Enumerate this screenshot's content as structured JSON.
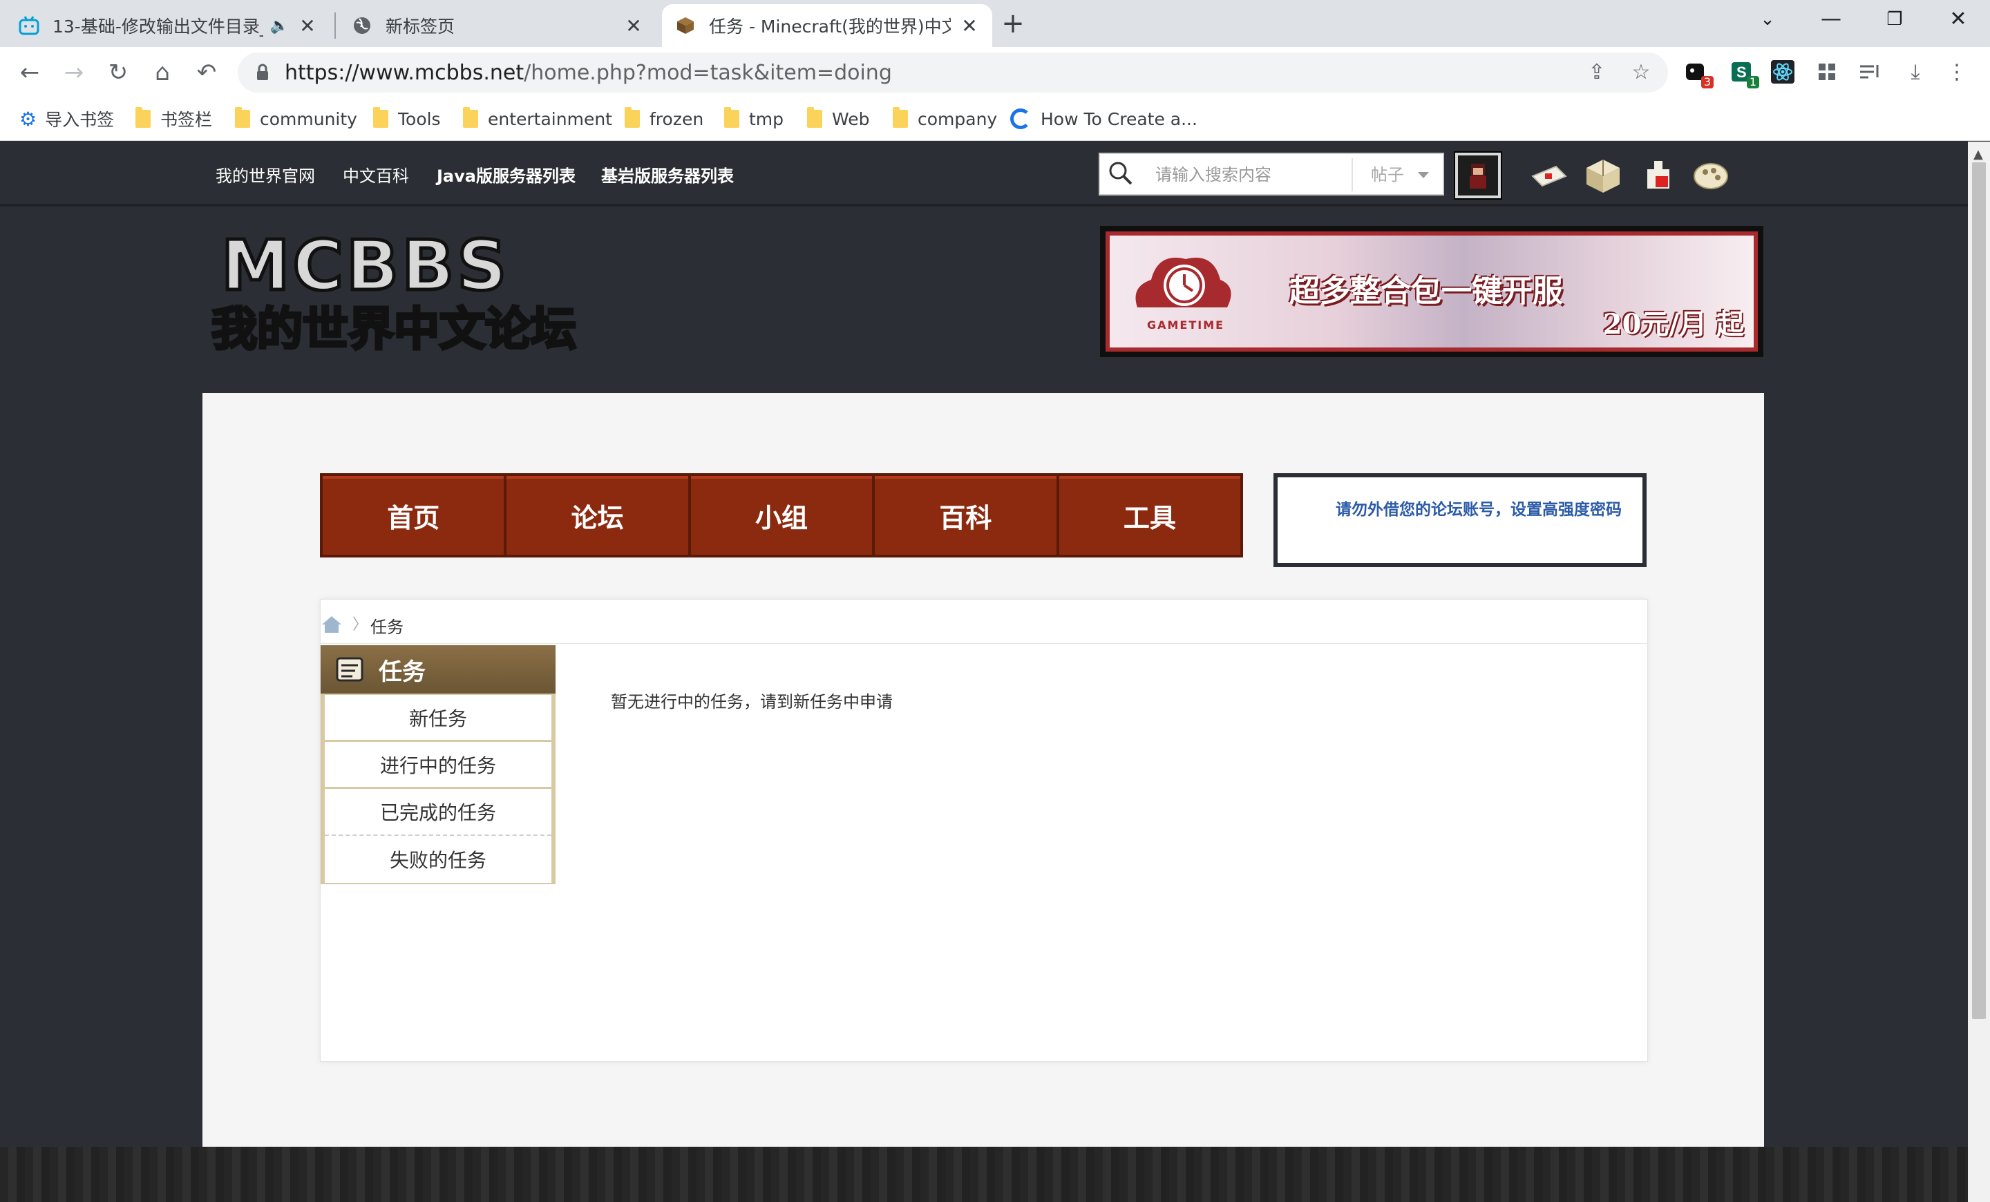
{
  "browser": {
    "tabs": [
      {
        "title": "13-基础-修改输出文件目录_",
        "icon": "bilibili-icon",
        "audio": "🔈"
      },
      {
        "title": "新标签页",
        "icon": "globe-icon"
      },
      {
        "title": "任务 - Minecraft(我的世界)中文",
        "icon": "minecraft-block-icon"
      }
    ],
    "url_host": "https://www.mcbbs.net",
    "url_path": "/home.php?mod=task&item=doing",
    "extensions_badges": {
      "ext1": "3",
      "ext2": "1"
    },
    "bookmarks": [
      {
        "label": "导入书签",
        "icon": "gear-icon"
      },
      {
        "label": "书签栏",
        "icon": "folder-icon"
      },
      {
        "label": "community",
        "icon": "folder-icon"
      },
      {
        "label": "Tools",
        "icon": "folder-icon"
      },
      {
        "label": "entertainment",
        "icon": "folder-icon"
      },
      {
        "label": "frozen",
        "icon": "folder-icon"
      },
      {
        "label": "tmp",
        "icon": "folder-icon"
      },
      {
        "label": "Web",
        "icon": "folder-icon"
      },
      {
        "label": "company",
        "icon": "folder-icon"
      },
      {
        "label": "How To Create a...",
        "icon": "sync-icon"
      }
    ]
  },
  "site": {
    "topnav": [
      "我的世界官网",
      "中文百科",
      "Java版服务器列表",
      "基岩版服务器列表"
    ],
    "search": {
      "placeholder": "请输入搜索内容",
      "scope": "帖子"
    },
    "logo_text": "MCBBS 我的世界中文论坛",
    "banner": {
      "headline": "超多整合包一键开服",
      "price": "20元/月 起",
      "brand": "GAMETIME"
    },
    "mainnav": [
      "首页",
      "论坛",
      "小组",
      "百科",
      "工具"
    ],
    "notice": "请勿外借您的论坛账号，设置高强度密码",
    "breadcrumb": {
      "current": "任务"
    },
    "sidebar": {
      "title": "任务",
      "items": [
        "新任务",
        "进行中的任务",
        "已完成的任务",
        "失败的任务"
      ]
    },
    "empty_message": "暂无进行中的任务，请到新任务中申请"
  },
  "colors": {
    "nav_brown": "#8c2a10",
    "page_dark": "#2b2e34",
    "notice_blue": "#2b5aa8",
    "sidebar_tan": "#d9c9a2"
  }
}
